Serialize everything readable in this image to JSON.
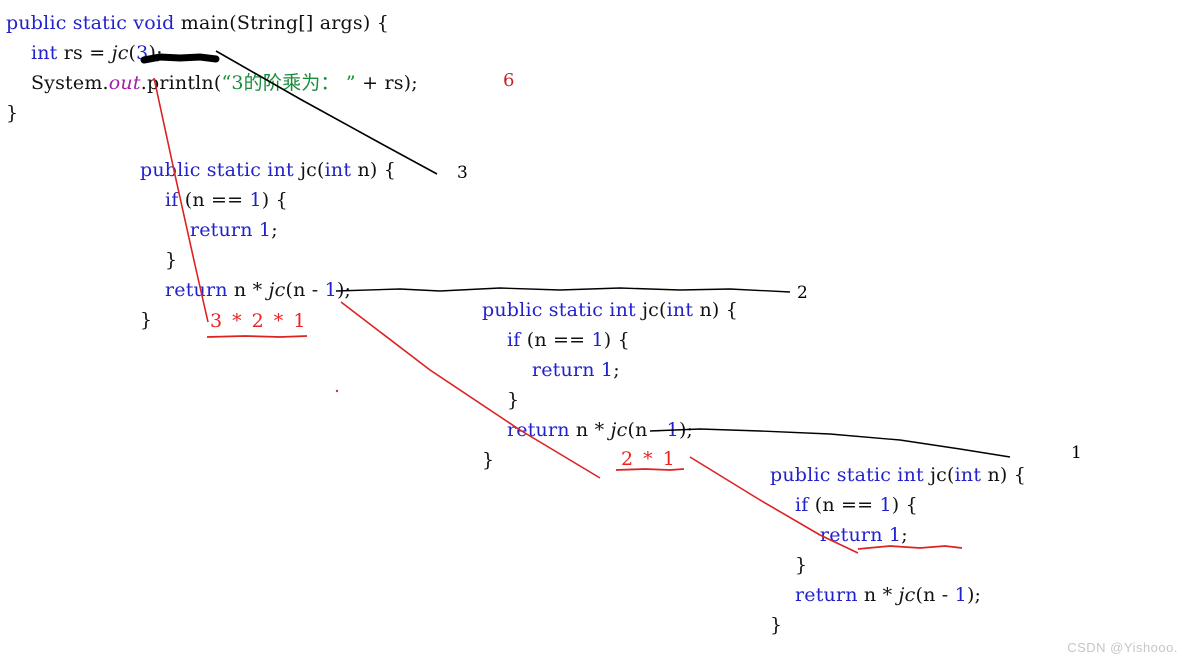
{
  "page": {
    "title": "Java recursion factorial trace diagram",
    "background": "#ffffff",
    "watermark": "CSDN @Yishooo."
  },
  "colors": {
    "keyword": "#2222cc",
    "number": "#2222cc",
    "string": "#1a8c3a",
    "field": "#a020b0",
    "plain": "#111111",
    "annotation_red": "#ee2222",
    "annotation_black": "#000000",
    "watermark": "#c6c6c6"
  },
  "blocks": {
    "main": {
      "name": "main-method-block",
      "lines": [
        {
          "tokens": [
            {
              "t": "public static void ",
              "c": "kw"
            },
            {
              "t": "main",
              "c": "plain"
            },
            {
              "t": "(",
              "c": "plain"
            },
            {
              "t": "String",
              "c": "plain"
            },
            {
              "t": "[] args) {",
              "c": "plain"
            }
          ]
        },
        {
          "tokens": [
            {
              "t": "    ",
              "c": "plain"
            },
            {
              "t": "int",
              "c": "kw"
            },
            {
              "t": " rs = ",
              "c": "plain"
            },
            {
              "t": "jc",
              "c": "meth"
            },
            {
              "t": "(",
              "c": "plain"
            },
            {
              "t": "3",
              "c": "num"
            },
            {
              "t": ");",
              "c": "plain"
            }
          ]
        },
        {
          "tokens": [
            {
              "t": "    System.",
              "c": "plain"
            },
            {
              "t": "out",
              "c": "fld"
            },
            {
              "t": ".println(",
              "c": "plain"
            },
            {
              "t": "“3的阶乘为： ”",
              "c": "str"
            },
            {
              "t": " + rs);",
              "c": "plain"
            }
          ]
        },
        {
          "tokens": [
            {
              "t": "}",
              "c": "plain"
            }
          ]
        }
      ]
    },
    "jc_level_3": {
      "name": "jc-call-level-3",
      "badge": "3",
      "lines": [
        {
          "tokens": [
            {
              "t": "public static int ",
              "c": "kw"
            },
            {
              "t": "jc",
              "c": "plain"
            },
            {
              "t": "(",
              "c": "plain"
            },
            {
              "t": "int",
              "c": "kw"
            },
            {
              "t": " n) {",
              "c": "plain"
            }
          ]
        },
        {
          "tokens": [
            {
              "t": "    ",
              "c": "plain"
            },
            {
              "t": "if",
              "c": "kw"
            },
            {
              "t": " (n == ",
              "c": "plain"
            },
            {
              "t": "1",
              "c": "num"
            },
            {
              "t": ") {",
              "c": "plain"
            }
          ]
        },
        {
          "tokens": [
            {
              "t": "        ",
              "c": "plain"
            },
            {
              "t": "return",
              "c": "kw"
            },
            {
              "t": " ",
              "c": "plain"
            },
            {
              "t": "1",
              "c": "num"
            },
            {
              "t": ";",
              "c": "plain"
            }
          ]
        },
        {
          "tokens": [
            {
              "t": "    }",
              "c": "plain"
            }
          ]
        },
        {
          "tokens": [
            {
              "t": "    ",
              "c": "plain"
            },
            {
              "t": "return",
              "c": "kw"
            },
            {
              "t": " n * ",
              "c": "plain"
            },
            {
              "t": "jc",
              "c": "meth"
            },
            {
              "t": "(n - ",
              "c": "plain"
            },
            {
              "t": "1",
              "c": "num"
            },
            {
              "t": ");",
              "c": "plain"
            }
          ]
        },
        {
          "tokens": [
            {
              "t": "}",
              "c": "plain"
            }
          ]
        }
      ]
    },
    "jc_level_2": {
      "name": "jc-call-level-2",
      "badge": "2",
      "lines": [
        {
          "tokens": [
            {
              "t": "public static int ",
              "c": "kw"
            },
            {
              "t": "jc",
              "c": "plain"
            },
            {
              "t": "(",
              "c": "plain"
            },
            {
              "t": "int",
              "c": "kw"
            },
            {
              "t": " n) {",
              "c": "plain"
            }
          ]
        },
        {
          "tokens": [
            {
              "t": "    ",
              "c": "plain"
            },
            {
              "t": "if",
              "c": "kw"
            },
            {
              "t": " (n == ",
              "c": "plain"
            },
            {
              "t": "1",
              "c": "num"
            },
            {
              "t": ") {",
              "c": "plain"
            }
          ]
        },
        {
          "tokens": [
            {
              "t": "        ",
              "c": "plain"
            },
            {
              "t": "return",
              "c": "kw"
            },
            {
              "t": " ",
              "c": "plain"
            },
            {
              "t": "1",
              "c": "num"
            },
            {
              "t": ";",
              "c": "plain"
            }
          ]
        },
        {
          "tokens": [
            {
              "t": "    }",
              "c": "plain"
            }
          ]
        },
        {
          "tokens": [
            {
              "t": "    ",
              "c": "plain"
            },
            {
              "t": "return",
              "c": "kw"
            },
            {
              "t": " n * ",
              "c": "plain"
            },
            {
              "t": "jc",
              "c": "meth"
            },
            {
              "t": "(n - ",
              "c": "plain"
            },
            {
              "t": "1",
              "c": "num"
            },
            {
              "t": ");",
              "c": "plain"
            }
          ]
        },
        {
          "tokens": [
            {
              "t": "}",
              "c": "plain"
            }
          ]
        }
      ]
    },
    "jc_level_1": {
      "name": "jc-call-level-1",
      "badge": "1",
      "lines": [
        {
          "tokens": [
            {
              "t": "public static int ",
              "c": "kw"
            },
            {
              "t": "jc",
              "c": "plain"
            },
            {
              "t": "(",
              "c": "plain"
            },
            {
              "t": "int",
              "c": "kw"
            },
            {
              "t": " n) {",
              "c": "plain"
            }
          ]
        },
        {
          "tokens": [
            {
              "t": "    ",
              "c": "plain"
            },
            {
              "t": "if",
              "c": "kw"
            },
            {
              "t": " (n == ",
              "c": "plain"
            },
            {
              "t": "1",
              "c": "num"
            },
            {
              "t": ") {",
              "c": "plain"
            }
          ]
        },
        {
          "tokens": [
            {
              "t": "        ",
              "c": "plain"
            },
            {
              "t": "return",
              "c": "kw"
            },
            {
              "t": " ",
              "c": "plain"
            },
            {
              "t": "1",
              "c": "num"
            },
            {
              "t": ";",
              "c": "plain"
            }
          ]
        },
        {
          "tokens": [
            {
              "t": "    }",
              "c": "plain"
            }
          ]
        },
        {
          "tokens": [
            {
              "t": "    ",
              "c": "plain"
            },
            {
              "t": "return",
              "c": "kw"
            },
            {
              "t": " n * ",
              "c": "plain"
            },
            {
              "t": "jc",
              "c": "meth"
            },
            {
              "t": "(n - ",
              "c": "plain"
            },
            {
              "t": "1",
              "c": "num"
            },
            {
              "t": ");",
              "c": "plain"
            }
          ]
        },
        {
          "tokens": [
            {
              "t": "}",
              "c": "plain"
            }
          ]
        }
      ]
    }
  },
  "annotations": {
    "result_value": "6",
    "badge_level_3": "3",
    "badge_level_2": "2",
    "badge_level_1": "1",
    "expr_level_3": "3 * 2 * 1",
    "expr_level_2": "2 * 1"
  }
}
